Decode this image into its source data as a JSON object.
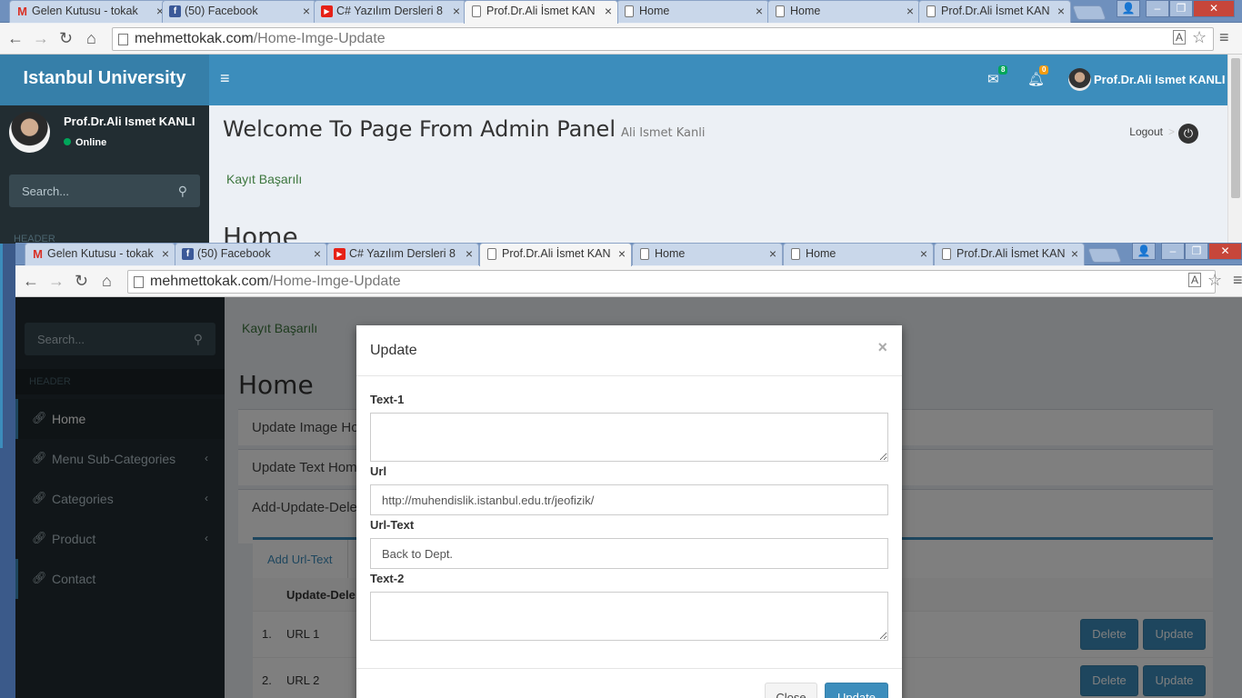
{
  "browser": {
    "tabs": [
      {
        "icon": "gmail",
        "title": "Gelen Kutusu - tokak"
      },
      {
        "icon": "facebook",
        "title": "(50) Facebook"
      },
      {
        "icon": "youtube",
        "title": "C# Yazılım Dersleri 8"
      },
      {
        "icon": "page",
        "title": "Prof.Dr.Ali İsmet KAN"
      },
      {
        "icon": "page",
        "title": "Home"
      },
      {
        "icon": "page",
        "title": "Home"
      },
      {
        "icon": "page",
        "title": "Prof.Dr.Ali İsmet KAN"
      }
    ],
    "url_host": "mehmettokak.com",
    "url_path": "/Home-Imge-Update"
  },
  "app": {
    "logo": "Istanbul University",
    "mail_count": "8",
    "notif_count": "0",
    "user_name": "Prof.Dr.Ali Ismet KANLI",
    "user_status": "Online",
    "search_placeholder": "Search...",
    "sidebar_header": "HEADER",
    "menu": [
      {
        "label": "Home",
        "active": true
      },
      {
        "label": "Menu Sub-Categories",
        "has_children": true
      },
      {
        "label": "Categories",
        "has_children": true
      },
      {
        "label": "Product",
        "has_children": true
      },
      {
        "label": "Contact"
      }
    ]
  },
  "page": {
    "title": "Welcome To Page From Admin Panel",
    "subtitle": "Ali Ismet Kanli",
    "logout": "Logout",
    "breadcrumb_sep": ">",
    "success": "Kayıt Başarılı",
    "section_title": "Home",
    "boxes": [
      "Update Image Ho",
      "Update Text Hom",
      "Add-Update-Dele"
    ],
    "nav_tab": "Add Url-Text",
    "table_header": "Update-Dele",
    "rows": [
      {
        "n": "1.",
        "label": "URL 1"
      },
      {
        "n": "2.",
        "label": "URL 2"
      }
    ],
    "btn_delete": "Delete",
    "btn_update": "Update"
  },
  "modal": {
    "title": "Update",
    "close_x": "×",
    "fields": {
      "text1_label": "Text-1",
      "text1_value": "",
      "url_label": "Url",
      "url_value": "http://muhendislik.istanbul.edu.tr/jeofizik/",
      "urltext_label": "Url-Text",
      "urltext_value": "Back to Dept.",
      "text2_label": "Text-2",
      "text2_value": ""
    },
    "close_button": "Close",
    "update_button": "Update"
  },
  "colors": {
    "brand": "#3c8dbc",
    "sidebar": "#222d32",
    "success": "#3c763d"
  }
}
